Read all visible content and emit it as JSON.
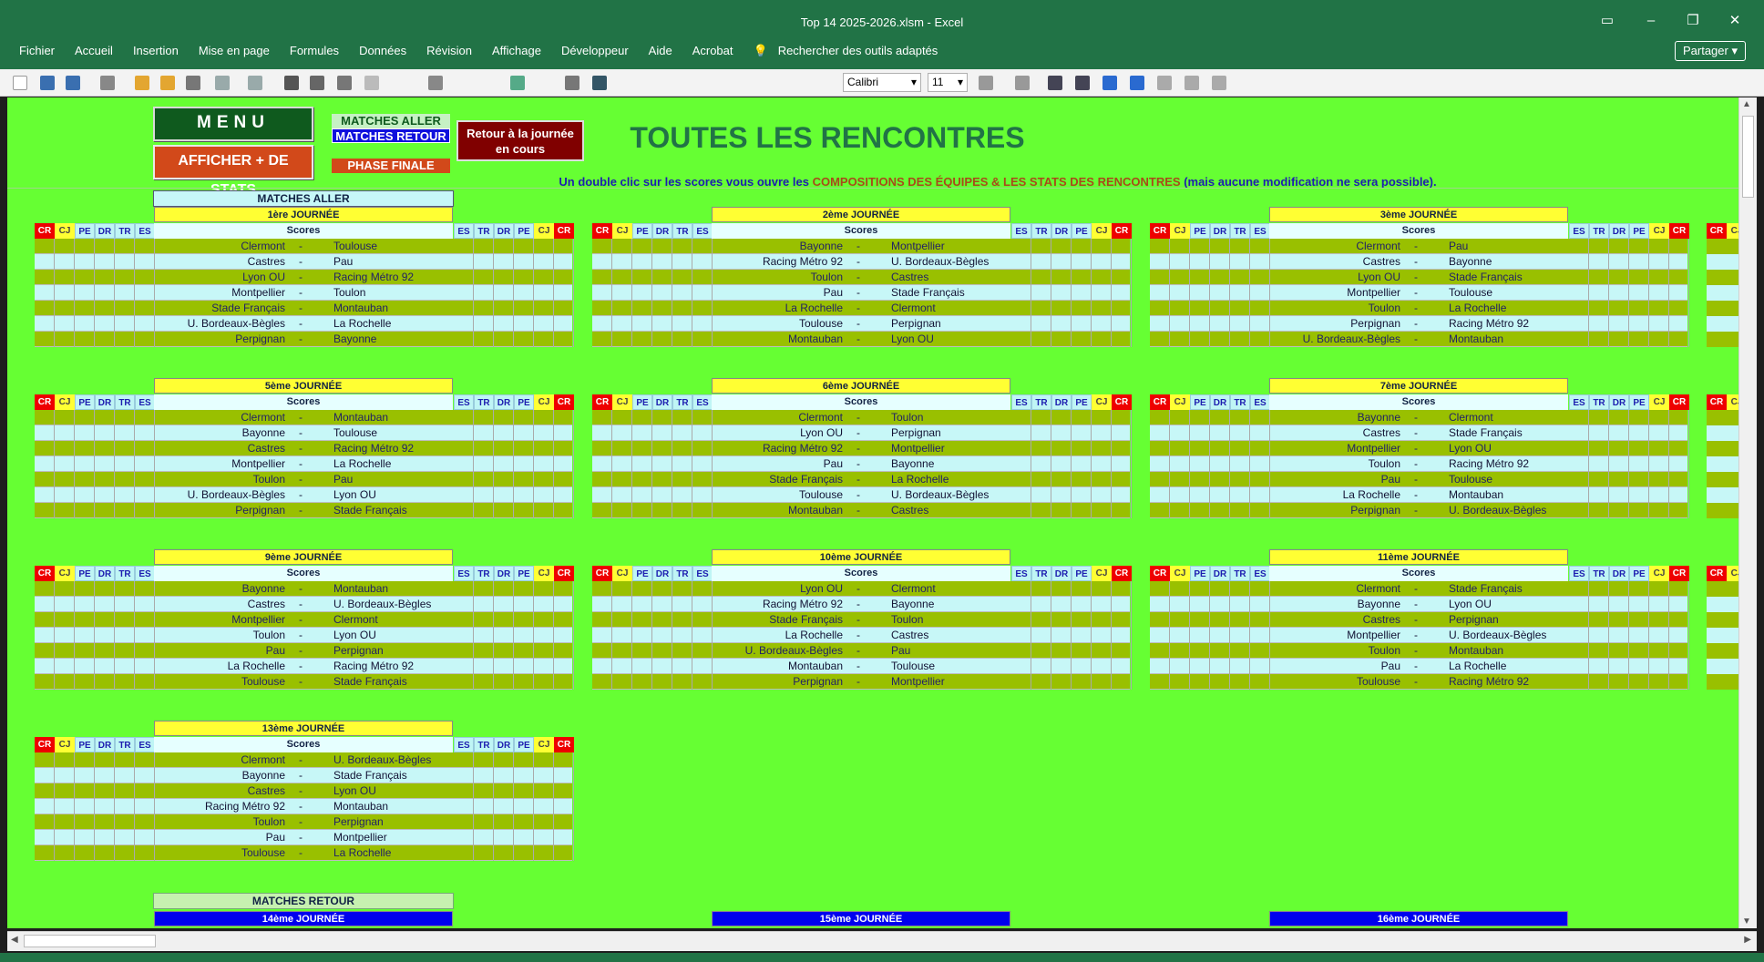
{
  "window": {
    "title": "Top 14 2025-2026.xlsm  -  Excel",
    "share": "Partager"
  },
  "menu": [
    "Fichier",
    "Accueil",
    "Insertion",
    "Mise en page",
    "Formules",
    "Données",
    "Révision",
    "Affichage",
    "Développeur",
    "Aide",
    "Acrobat"
  ],
  "search": "Rechercher des outils adaptés",
  "toolbar": {
    "font": "Calibri",
    "size": "11"
  },
  "buttons": {
    "menu": "MENU",
    "stats": "AFFICHER + DE STATS",
    "aller": "MATCHES ALLER",
    "retour": "MATCHES RETOUR",
    "finale": "PHASE FINALE",
    "retour_journee": "Retour à la journée en cours"
  },
  "page": {
    "title": "TOUTES LES RENCONTRES",
    "hint_a": "Un double clic sur les scores vous ouvre les ",
    "hint_b": "COMPOSITIONS DES ÉQUIPES & LES STATS DES RENCONTRES",
    "hint_c": " (mais aucune modification ne sera possible)."
  },
  "sections": {
    "aller": "MATCHES ALLER",
    "retour": "MATCHES RETOUR"
  },
  "cols_left": [
    "CR",
    "CJ",
    "PE",
    "DR",
    "TR",
    "ES"
  ],
  "cols_right": [
    "ES",
    "TR",
    "DR",
    "PE",
    "CJ",
    "CR"
  ],
  "scores_label": "Scores",
  "journees": [
    {
      "title": "1ère JOURNÉE",
      "matches": [
        [
          "Clermont",
          "Toulouse"
        ],
        [
          "Castres",
          "Pau"
        ],
        [
          "Lyon OU",
          "Racing Métro 92"
        ],
        [
          "Montpellier",
          "Toulon"
        ],
        [
          "Stade Français",
          "Montauban"
        ],
        [
          "U. Bordeaux-Bègles",
          "La Rochelle"
        ],
        [
          "Perpignan",
          "Bayonne"
        ]
      ]
    },
    {
      "title": "2ème JOURNÉE",
      "matches": [
        [
          "Bayonne",
          "Montpellier"
        ],
        [
          "Racing Métro 92",
          "U. Bordeaux-Bègles"
        ],
        [
          "Toulon",
          "Castres"
        ],
        [
          "Pau",
          "Stade Français"
        ],
        [
          "La Rochelle",
          "Clermont"
        ],
        [
          "Toulouse",
          "Perpignan"
        ],
        [
          "Montauban",
          "Lyon OU"
        ]
      ]
    },
    {
      "title": "3ème JOURNÉE",
      "matches": [
        [
          "Clermont",
          "Pau"
        ],
        [
          "Castres",
          "Bayonne"
        ],
        [
          "Lyon OU",
          "Stade Français"
        ],
        [
          "Montpellier",
          "Toulouse"
        ],
        [
          "Toulon",
          "La Rochelle"
        ],
        [
          "Perpignan",
          "Racing Métro 92"
        ],
        [
          "U. Bordeaux-Bègles",
          "Montauban"
        ]
      ]
    },
    {
      "title": "5ème JOURNÉE",
      "matches": [
        [
          "Clermont",
          "Montauban"
        ],
        [
          "Bayonne",
          "Toulouse"
        ],
        [
          "Castres",
          "Racing Métro 92"
        ],
        [
          "Montpellier",
          "La Rochelle"
        ],
        [
          "Toulon",
          "Pau"
        ],
        [
          "U. Bordeaux-Bègles",
          "Lyon OU"
        ],
        [
          "Perpignan",
          "Stade Français"
        ]
      ]
    },
    {
      "title": "6ème JOURNÉE",
      "matches": [
        [
          "Clermont",
          "Toulon"
        ],
        [
          "Lyon OU",
          "Perpignan"
        ],
        [
          "Racing Métro 92",
          "Montpellier"
        ],
        [
          "Pau",
          "Bayonne"
        ],
        [
          "Stade Français",
          "La Rochelle"
        ],
        [
          "Toulouse",
          "U. Bordeaux-Bègles"
        ],
        [
          "Montauban",
          "Castres"
        ]
      ]
    },
    {
      "title": "7ème JOURNÉE",
      "matches": [
        [
          "Bayonne",
          "Clermont"
        ],
        [
          "Castres",
          "Stade Français"
        ],
        [
          "Montpellier",
          "Lyon OU"
        ],
        [
          "Toulon",
          "Racing Métro 92"
        ],
        [
          "Pau",
          "Toulouse"
        ],
        [
          "La Rochelle",
          "Montauban"
        ],
        [
          "Perpignan",
          "U. Bordeaux-Bègles"
        ]
      ]
    },
    {
      "title": "9ème JOURNÉE",
      "matches": [
        [
          "Bayonne",
          "Montauban"
        ],
        [
          "Castres",
          "U. Bordeaux-Bègles"
        ],
        [
          "Montpellier",
          "Clermont"
        ],
        [
          "Toulon",
          "Lyon OU"
        ],
        [
          "Pau",
          "Perpignan"
        ],
        [
          "La Rochelle",
          "Racing Métro 92"
        ],
        [
          "Toulouse",
          "Stade Français"
        ]
      ]
    },
    {
      "title": "10ème JOURNÉE",
      "matches": [
        [
          "Lyon OU",
          "Clermont"
        ],
        [
          "Racing Métro 92",
          "Bayonne"
        ],
        [
          "Stade Français",
          "Toulon"
        ],
        [
          "La Rochelle",
          "Castres"
        ],
        [
          "U. Bordeaux-Bègles",
          "Pau"
        ],
        [
          "Montauban",
          "Toulouse"
        ],
        [
          "Perpignan",
          "Montpellier"
        ]
      ]
    },
    {
      "title": "11ème JOURNÉE",
      "matches": [
        [
          "Clermont",
          "Stade Français"
        ],
        [
          "Bayonne",
          "Lyon OU"
        ],
        [
          "Castres",
          "Perpignan"
        ],
        [
          "Montpellier",
          "U. Bordeaux-Bègles"
        ],
        [
          "Toulon",
          "Montauban"
        ],
        [
          "Pau",
          "La Rochelle"
        ],
        [
          "Toulouse",
          "Racing Métro 92"
        ]
      ]
    },
    {
      "title": "13ème JOURNÉE",
      "matches": [
        [
          "Clermont",
          "U. Bordeaux-Bègles"
        ],
        [
          "Bayonne",
          "Stade Français"
        ],
        [
          "Castres",
          "Lyon OU"
        ],
        [
          "Racing Métro 92",
          "Montauban"
        ],
        [
          "Toulon",
          "Perpignan"
        ],
        [
          "Pau",
          "Montpellier"
        ],
        [
          "Toulouse",
          "La Rochelle"
        ]
      ]
    }
  ],
  "retour_journees": [
    "14ème JOURNÉE",
    "15ème JOURNÉE",
    "16ème JOURNÉE"
  ]
}
